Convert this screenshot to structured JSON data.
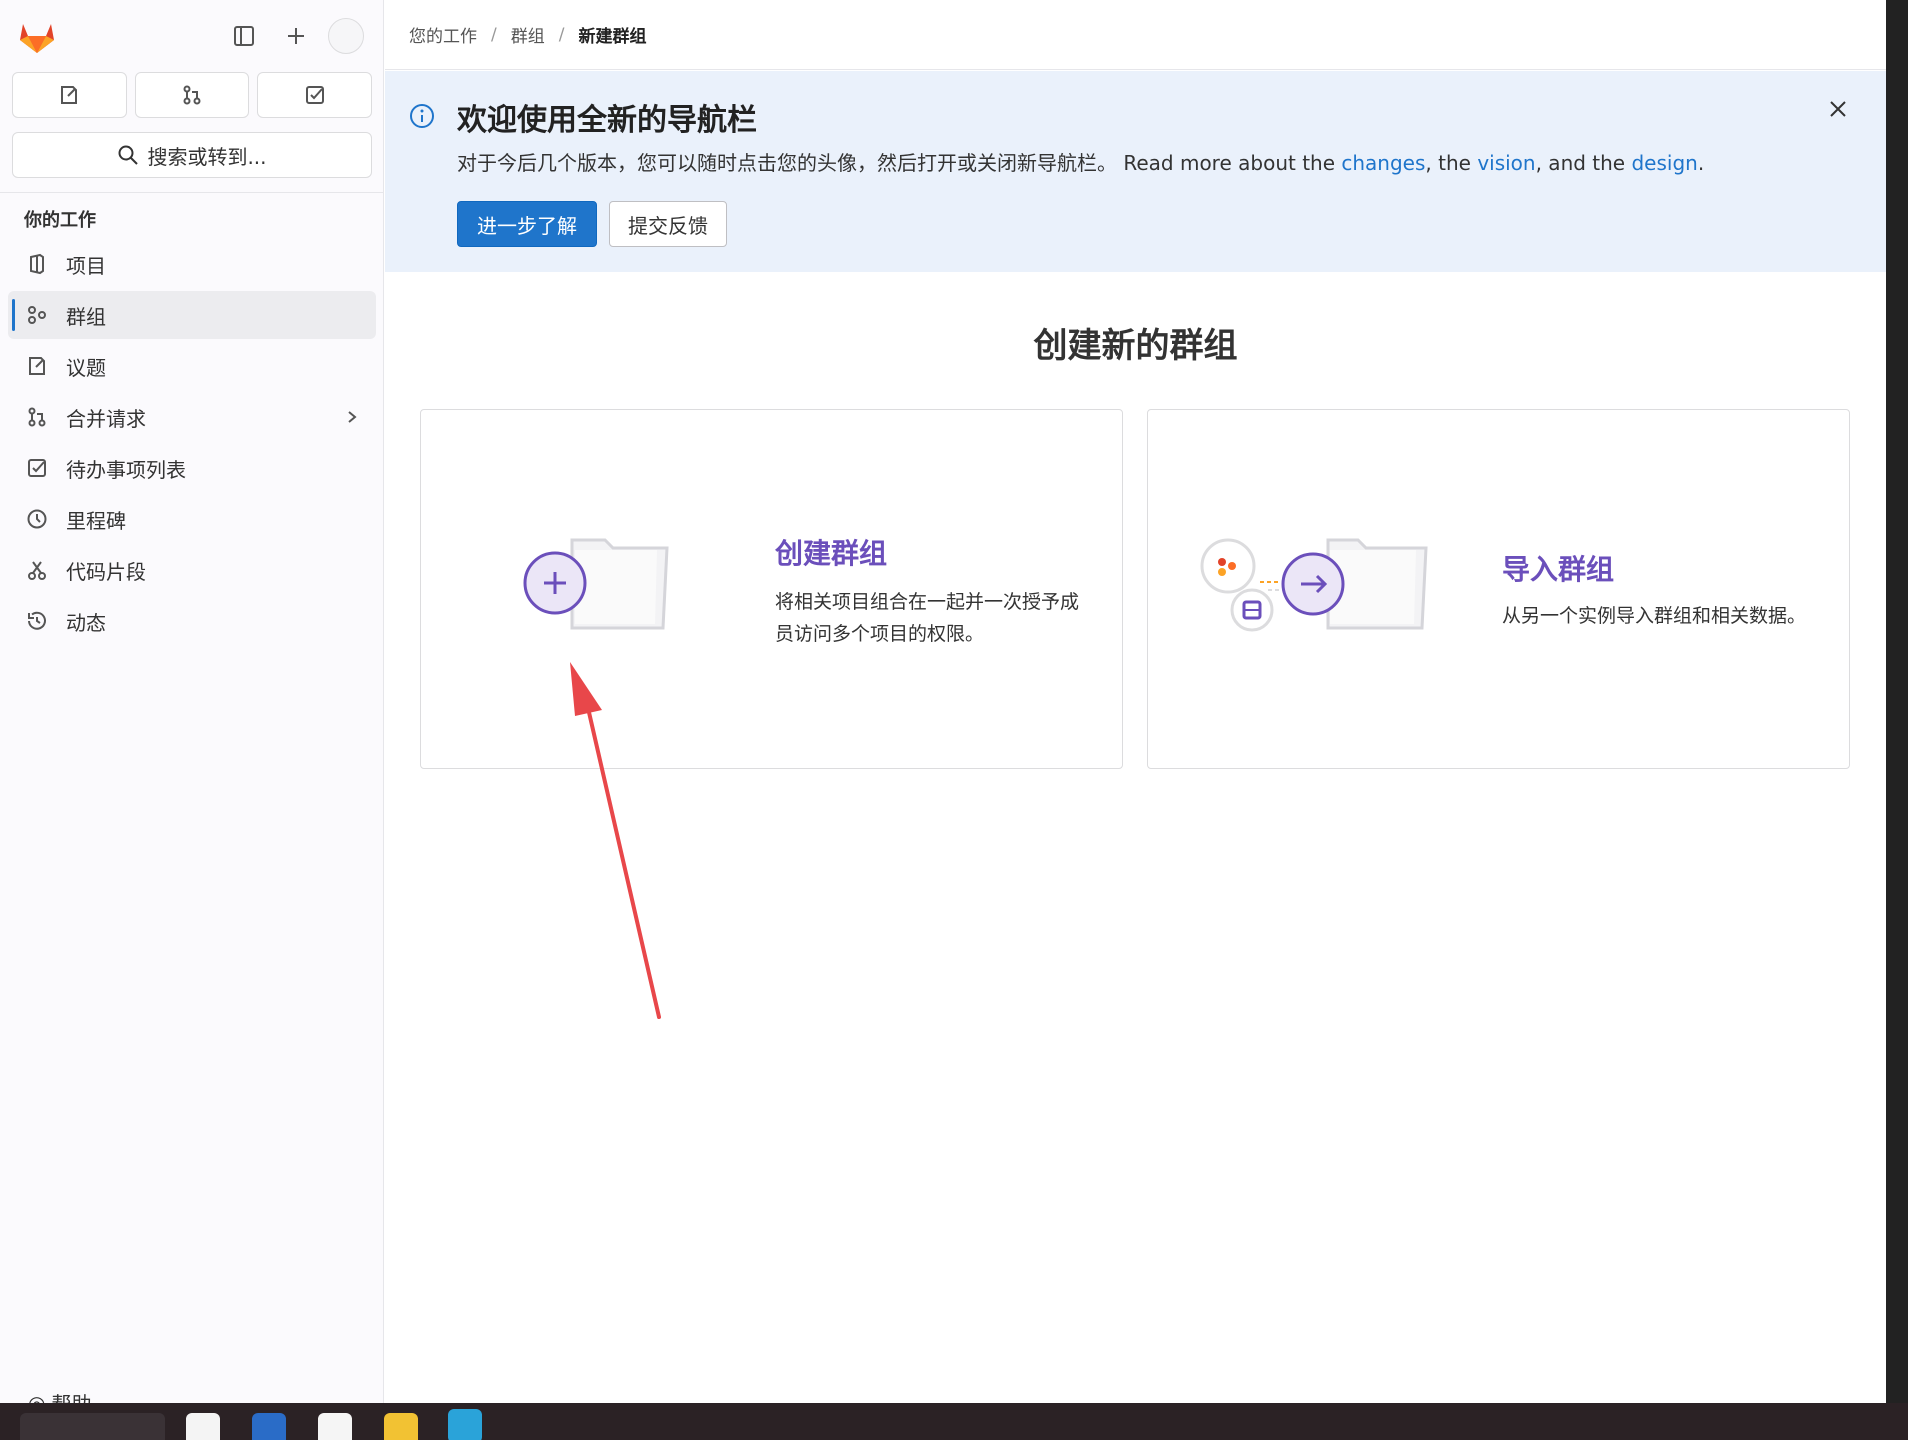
{
  "sidebar": {
    "search_label": "搜索或转到...",
    "section_title": "你的工作",
    "items": [
      {
        "label": "项目",
        "icon": "project-icon"
      },
      {
        "label": "群组",
        "icon": "group-icon"
      },
      {
        "label": "议题",
        "icon": "issue-icon"
      },
      {
        "label": "合并请求",
        "icon": "merge-request-icon"
      },
      {
        "label": "待办事项列表",
        "icon": "todo-icon"
      },
      {
        "label": "里程碑",
        "icon": "clock-icon"
      },
      {
        "label": "代码片段",
        "icon": "snippet-icon"
      },
      {
        "label": "动态",
        "icon": "history-icon"
      }
    ],
    "help_label": "帮助"
  },
  "breadcrumb": {
    "items": [
      "您的工作",
      "群组"
    ],
    "current": "新建群组"
  },
  "banner": {
    "title": "欢迎使用全新的导航栏",
    "text_prefix": "对于今后几个版本，您可以随时点击您的头像，然后打开或关闭新导航栏。 Read more about the ",
    "link_changes": "changes",
    "text_mid1": ", the ",
    "link_vision": "vision",
    "text_mid2": ", and the ",
    "link_design": "design",
    "text_suffix": ".",
    "primary_button": "进一步了解",
    "secondary_button": "提交反馈"
  },
  "main": {
    "title": "创建新的群组",
    "cards": [
      {
        "title": "创建群组",
        "desc_line1": "将相关项目组合在一起并一次授予成",
        "desc_line2": "员访问多个项目的权限。"
      },
      {
        "title": "导入群组",
        "desc_line1": "从另一个实例导入群组和相关数据。"
      }
    ]
  },
  "colors": {
    "accent": "#1f75cb",
    "purple": "#6b4fbb",
    "annotation_arrow": "#e8474a"
  }
}
